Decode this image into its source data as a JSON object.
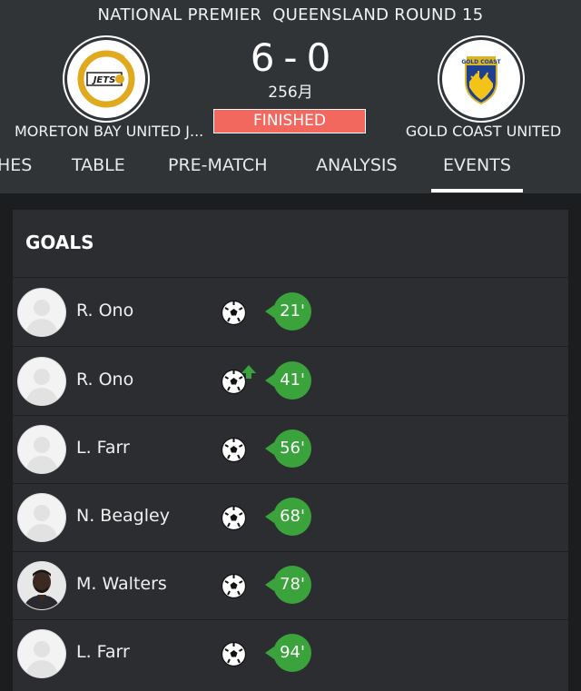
{
  "match": {
    "competition": "NATIONAL PREMIER  QUEENSLAND ROUND 15",
    "home_team": "MORETON BAY UNITED J...",
    "away_team": "GOLD COAST UNITED",
    "home_score": "6",
    "away_score": "0",
    "score_separator": "-",
    "date": "256月",
    "status": "FINISHED",
    "home_crest_text": "JETS",
    "away_crest_text": "GOLD COAST",
    "status_color": "#f2675e"
  },
  "tabs": [
    {
      "label": "HES"
    },
    {
      "label": "TABLE"
    },
    {
      "label": "PRE-MATCH"
    },
    {
      "label": "ANALYSIS"
    },
    {
      "label": "EVENTS",
      "active": true
    }
  ],
  "goals": {
    "title": "GOALS",
    "items": [
      {
        "player": "R. Ono",
        "minute": "21'",
        "icon": "soccer-ball-icon"
      },
      {
        "player": "R. Ono",
        "minute": "41'",
        "icon": "soccer-ball-icon",
        "badge": "arrow-up-icon"
      },
      {
        "player": "L. Farr",
        "minute": "56'",
        "icon": "soccer-ball-icon"
      },
      {
        "player": "N. Beagley",
        "minute": "68'",
        "icon": "soccer-ball-icon"
      },
      {
        "player": "M. Walters",
        "minute": "78'",
        "icon": "soccer-ball-icon",
        "photo": true
      },
      {
        "player": "L. Farr",
        "minute": "94'",
        "icon": "soccer-ball-icon"
      }
    ]
  },
  "colors": {
    "header_bg": "#313437",
    "card_bg": "#2b2d30",
    "minute_badge": "#3aa33b"
  }
}
